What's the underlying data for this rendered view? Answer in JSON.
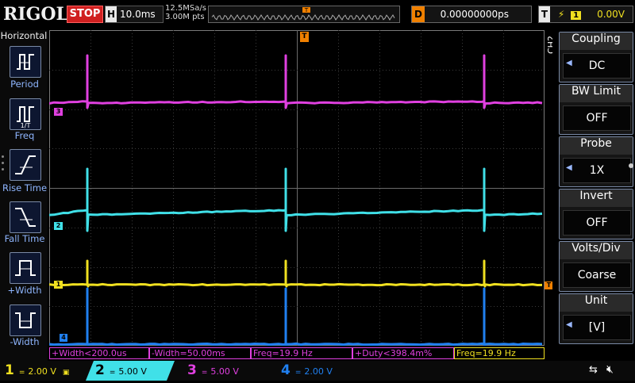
{
  "brand": "RIGOL",
  "run_state": "STOP",
  "horizontal": {
    "letter": "H",
    "timebase": "10.0ms"
  },
  "sampling": {
    "rate": "12.5MSa/s",
    "points": "3.00M pts"
  },
  "delay": {
    "letter": "D",
    "value": "0.00000000ps"
  },
  "trigger": {
    "letter": "T",
    "channel": "1",
    "level": "0.00V"
  },
  "left_panel": {
    "title": "Horizontal",
    "items": [
      {
        "label": "Period",
        "icon": "period-icon"
      },
      {
        "label": "Freq",
        "icon": "freq-icon"
      },
      {
        "label": "Rise Time",
        "icon": "rise-time-icon"
      },
      {
        "label": "Fall Time",
        "icon": "fall-time-icon"
      },
      {
        "label": "+Width",
        "icon": "plus-width-icon"
      },
      {
        "label": "-Width",
        "icon": "minus-width-icon"
      }
    ]
  },
  "right_panel": {
    "channel_tag": "CH2",
    "items": [
      {
        "header": "Coupling",
        "value": "DC",
        "has_arrow": true
      },
      {
        "header": "BW Limit",
        "value": "OFF",
        "has_arrow": false
      },
      {
        "header": "Probe",
        "value": "1X",
        "has_arrow": true
      },
      {
        "header": "Invert",
        "value": "OFF",
        "has_arrow": false
      },
      {
        "header": "Volts/Div",
        "value": "Coarse",
        "has_arrow": false
      },
      {
        "header": "Unit",
        "value": "[V]",
        "has_arrow": true
      }
    ]
  },
  "trace_markers": {
    "ch3": "3",
    "ch2": "2",
    "ch1": "1",
    "ch4": "4",
    "trigger": "T"
  },
  "measurements": [
    {
      "text": "+Width<200.0us",
      "color": "#e040e0"
    },
    {
      "text": "-Width=50.00ms",
      "color": "#e040e0"
    },
    {
      "text": "Freq=19.9 Hz",
      "color": "#e040e0"
    },
    {
      "text": "+Duty<398.4m%",
      "color": "#e040e0"
    },
    {
      "text": "Freq=19.9 Hz",
      "color": "#f0e020"
    }
  ],
  "channels": [
    {
      "num": "1",
      "coupling": "=",
      "scale": "2.00 V",
      "color": "#f0e020",
      "active": false
    },
    {
      "num": "2",
      "coupling": "=",
      "scale": "5.00 V",
      "color": "#40e0e8",
      "active": true
    },
    {
      "num": "3",
      "coupling": "=",
      "scale": "5.00 V",
      "color": "#e040e0",
      "active": false
    },
    {
      "num": "4",
      "coupling": "=",
      "scale": "2.00 V",
      "color": "#2080f0",
      "active": false
    }
  ],
  "colors": {
    "ch1": "#f0e020",
    "ch2": "#40e0e8",
    "ch3": "#e040e0",
    "ch4": "#2080f0",
    "trigger": "#f08000"
  }
}
